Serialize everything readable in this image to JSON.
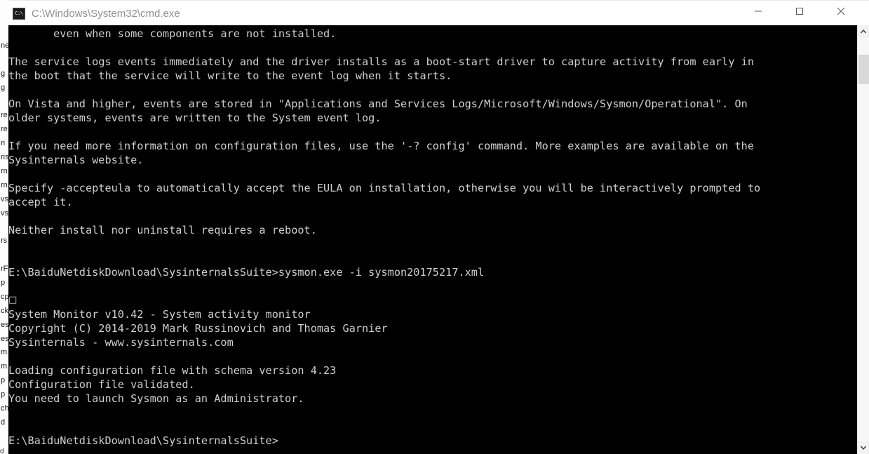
{
  "window": {
    "title": "C:\\Windows\\System32\\cmd.exe",
    "icon_label": "C:\\",
    "icon_name": "cmd-icon",
    "controls": {
      "minimize": "minimize-button",
      "maximize": "maximize-button",
      "close": "close-button"
    },
    "background_color": "#000000",
    "titlebar_color": "#ffffff",
    "text_color": "#cfcfcf"
  },
  "console": {
    "lines": [
      "       even when some components are not installed.",
      "",
      "The service logs events immediately and the driver installs as a boot-start driver to capture activity from early in",
      "the boot that the service will write to the event log when it starts.",
      "",
      "On Vista and higher, events are stored in \"Applications and Services Logs/Microsoft/Windows/Sysmon/Operational\". On",
      "older systems, events are written to the System event log.",
      "",
      "If you need more information on configuration files, use the '-? config' command. More examples are available on the",
      "Sysinternals website.",
      "",
      "Specify -accepteula to automatically accept the EULA on installation, otherwise you will be interactively prompted to",
      "accept it.",
      "",
      "Neither install nor uninstall requires a reboot.",
      "",
      "",
      "E:\\BaiduNetdiskDownload\\SysinternalsSuite>sysmon.exe -i sysmon20175217.xml",
      "",
      "□",
      "System Monitor v10.42 - System activity monitor",
      "Copyright (C) 2014-2019 Mark Russinovich and Thomas Garnier",
      "Sysinternals - www.sysinternals.com",
      "",
      "Loading configuration file with schema version 4.23",
      "Configuration file validated.",
      "You need to launch Sysmon as an Administrator.",
      "",
      "",
      "E:\\BaiduNetdiskDownload\\SysinternalsSuite>"
    ]
  },
  "scrollbar": {
    "up_arrow": "scroll-up-arrow",
    "down_arrow": "scroll-down-arrow",
    "thumb": "scroll-thumb"
  },
  "background_window": {
    "left_edge_fragments": [
      "",
      "ne",
      "",
      "g",
      "g",
      "",
      "re",
      "re",
      "ri",
      "ris",
      "rn",
      "rn",
      "vs",
      "vsN",
      "",
      "rs",
      "",
      "rFE",
      "p",
      "cp",
      "ck",
      "es",
      "es",
      "m",
      "m",
      "p",
      "p",
      "ch",
      "d"
    ],
    "top_faint": "           ",
    "bottom_faint": "                            ",
    "bottom_left_faint": "d"
  }
}
